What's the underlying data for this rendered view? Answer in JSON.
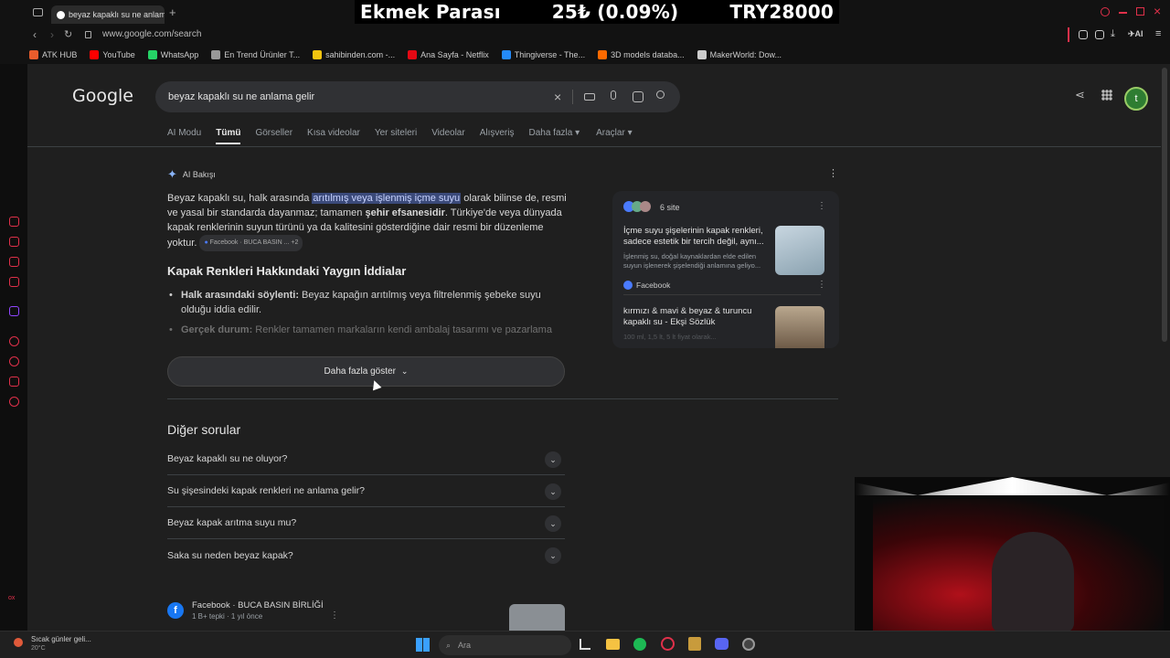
{
  "browser": {
    "tab_title": "beyaz kapaklı su ne anlama",
    "url": "www.google.com/search",
    "bookmarks": [
      {
        "label": "ATK HUB",
        "color": "#e85d2c"
      },
      {
        "label": "YouTube",
        "color": "#ff0000"
      },
      {
        "label": "WhatsApp",
        "color": "#25d366"
      },
      {
        "label": "En Trend Ürünler T...",
        "color": "#999999"
      },
      {
        "label": "sahibinden.com -...",
        "color": "#f1c40f"
      },
      {
        "label": "Ana Sayfa - Netflix",
        "color": "#e50914"
      },
      {
        "label": "Thingiverse - The...",
        "color": "#248bfb"
      },
      {
        "label": "3D models databa...",
        "color": "#ff6a00"
      },
      {
        "label": "MakerWorld: Dow...",
        "color": "#cccccc"
      }
    ]
  },
  "ticker": {
    "name": "Ekmek Parası",
    "change": "25₺ (0.09%)",
    "total": "TRY28000"
  },
  "google": {
    "logo": "Google",
    "query": "beyaz kapaklı su ne anlama gelir",
    "avatar_letter": "t",
    "tabs": [
      "AI Modu",
      "Tümü",
      "Görseller",
      "Kısa videolar",
      "Yer siteleri",
      "Videolar",
      "Alışveriş",
      "Daha fazla",
      "Araçlar"
    ]
  },
  "ai": {
    "label": "AI Bakışı",
    "p1_a": "Beyaz kapaklı su, halk arasında ",
    "p1_hl": "arıtılmış veya işlenmiş içme suyu",
    "p1_b": " olarak bilinse de, resmi ve yasal bir standarda dayanmaz; tamamen ",
    "p1_bold": "şehir efsanesidir",
    "p1_c": ". Türkiye'de veya dünyada kapak renklerinin suyun türünü ya da kalitesini gösterdiğine dair resmi bir düzenleme yoktur.",
    "chip": "Facebook · BUCA BASIN ... +2",
    "heading": "Kapak Renkleri Hakkındaki Yaygın İddialar",
    "b1_bold": "Halk arasındaki söylenti:",
    "b1_text": " Beyaz kapağın arıtılmış veya filtrelenmiş şebeke suyu olduğu iddia edilir.",
    "b2_bold": "Gerçek durum:",
    "b2_text": " Renkler tamamen markaların kendi ambalaj tasarımı ve pazarlama",
    "show_more": "Daha fazla göster"
  },
  "sources": {
    "count": "6 site",
    "card1_title": "İçme suyu şişelerinin kapak renkleri, sadece estetik bir tercih değil, aynı...",
    "card1_snippet": "İşlenmiş su, doğal kaynaklardan elde edilen suyun işlenerek şişelendiği anlamına geliyo...",
    "card1_source": "Facebook",
    "card2_title": "kırmızı & mavi & beyaz & turuncu kapaklı su - Ekşi Sözlük",
    "card2_snippet": "100 ml, 1,5 lt, 5 lt fiyat olarak..."
  },
  "questions": {
    "title": "Diğer sorular",
    "items": [
      "Beyaz kapaklı su ne oluyor?",
      "Su şişesindeki kapak renkleri ne anlama gelir?",
      "Beyaz kapak arıtma suyu mu?",
      "Saka su neden beyaz kapak?"
    ]
  },
  "result": {
    "source": "Facebook · BUCA BASIN BİRLİĞİ",
    "meta": "1 B+ tepki · 1 yıl önce"
  },
  "taskbar": {
    "weather_title": "Sıcak günler geli...",
    "weather_temp": "20°C",
    "search": "Ara"
  },
  "sidebar_label": "ox"
}
